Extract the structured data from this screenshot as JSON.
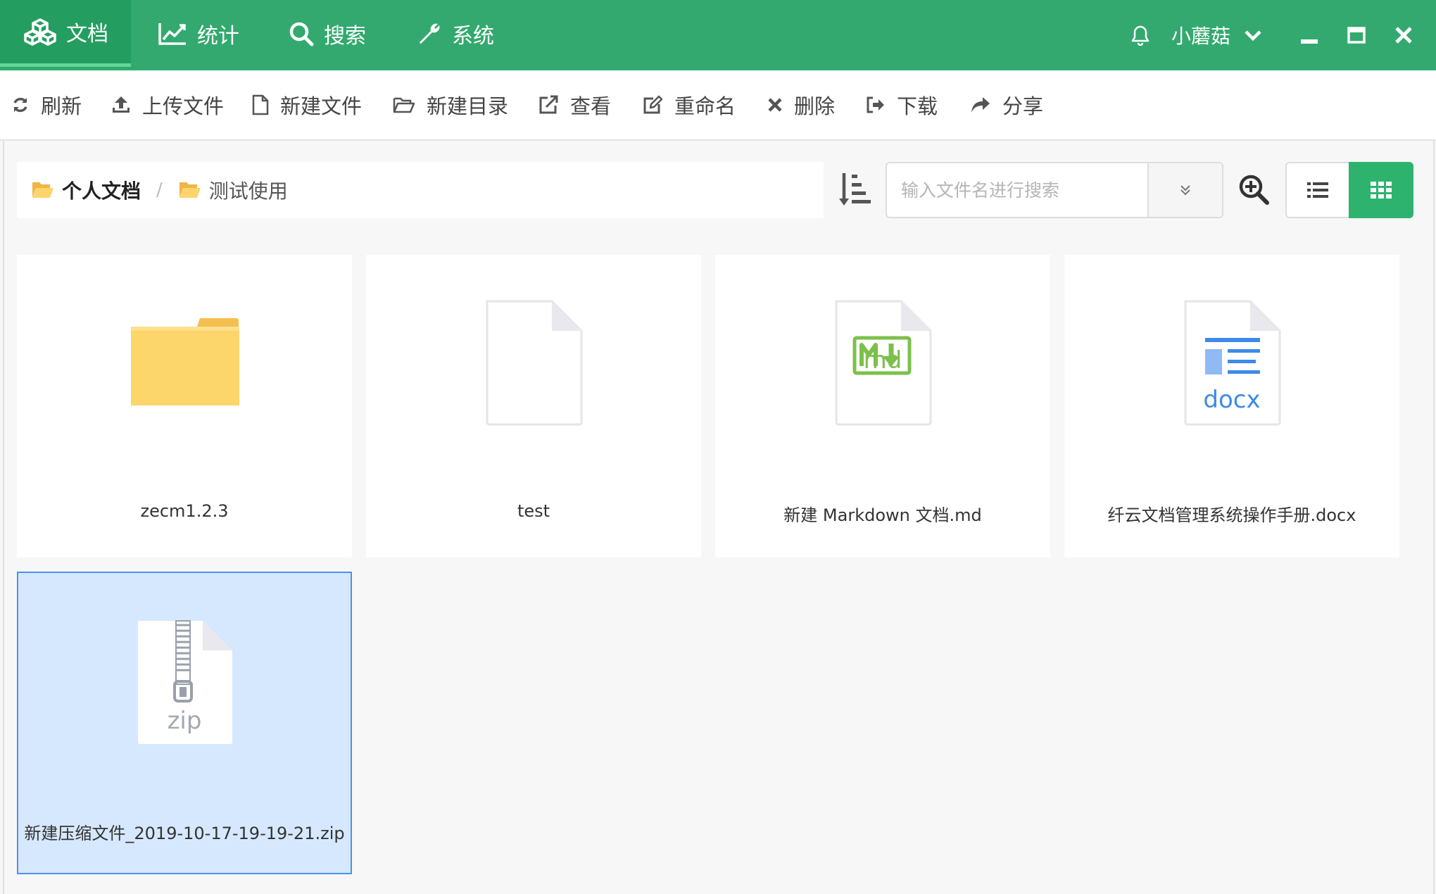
{
  "nav": {
    "tabs": [
      {
        "label": "文档",
        "icon": "cubes-icon",
        "active": true
      },
      {
        "label": "统计",
        "icon": "line-chart-icon"
      },
      {
        "label": "搜索",
        "icon": "search-icon"
      },
      {
        "label": "系统",
        "icon": "wrench-icon"
      }
    ],
    "user_name": "小蘑菇"
  },
  "toolbar": {
    "refresh": "刷新",
    "upload": "上传文件",
    "new_file": "新建文件",
    "new_folder": "新建目录",
    "view": "查看",
    "rename": "重命名",
    "delete": "删除",
    "download": "下载",
    "share": "分享"
  },
  "breadcrumb": {
    "root": "个人文档",
    "separator": "/",
    "current": "测试使用"
  },
  "search": {
    "placeholder": "输入文件名进行搜索"
  },
  "files": [
    {
      "name": "zecm1.2.3",
      "type": "folder"
    },
    {
      "name": "test",
      "type": "blank"
    },
    {
      "name": "新建 Markdown 文档.md",
      "type": "md",
      "badge": "md"
    },
    {
      "name": "纤云文档管理系统操作手册.docx",
      "type": "docx",
      "badge": "docx"
    },
    {
      "name": "新建压缩文件_2019-10-17-19-19-21.zip",
      "type": "zip",
      "badge": "zip",
      "selected": true
    }
  ],
  "colors": {
    "topbar": "#33a96f",
    "active_tab": "#249e60",
    "accent": "#2eb36f",
    "selected_card": "#d6e8fd",
    "selected_border": "#4c93ed",
    "folder": "#fcd56b",
    "md": "#7cc04b",
    "docx": "#3d8ae8"
  }
}
